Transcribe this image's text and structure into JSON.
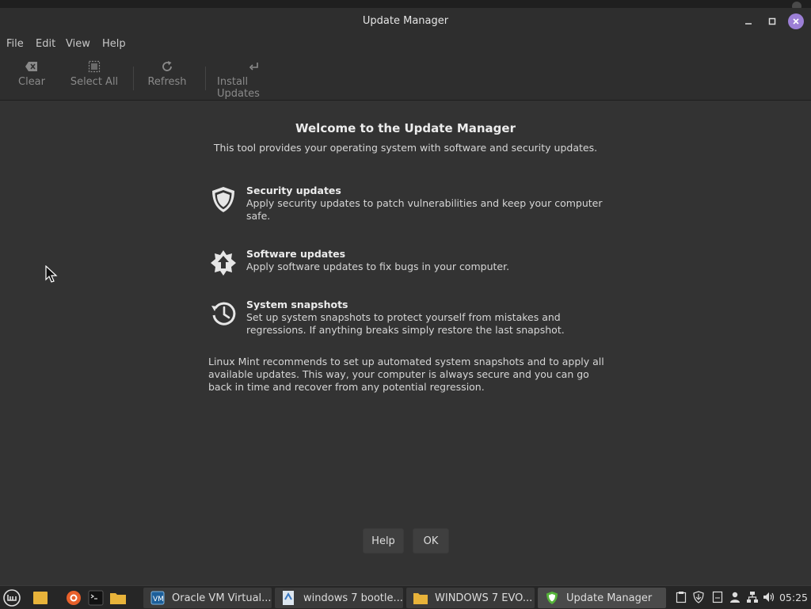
{
  "window": {
    "title": "Update Manager",
    "controls": {
      "minimize": "–",
      "maximize": "□",
      "close": "✕"
    }
  },
  "menubar": [
    "File",
    "Edit",
    "View",
    "Help"
  ],
  "toolbar": {
    "clear": {
      "label": "Clear",
      "icon": "clear-icon"
    },
    "select_all": {
      "label": "Select All",
      "icon": "select-all-icon"
    },
    "refresh": {
      "label": "Refresh",
      "icon": "refresh-icon"
    },
    "install": {
      "label": "Install Updates",
      "icon": "install-icon"
    }
  },
  "welcome": {
    "title": "Welcome to the Update Manager",
    "subtitle": "This tool provides your operating system with software and security updates.",
    "features": [
      {
        "heading": "Security updates",
        "description": "Apply security updates to patch vulnerabilities and keep your computer safe.",
        "icon": "shield-icon"
      },
      {
        "heading": "Software updates",
        "description": "Apply software updates to fix bugs in your computer.",
        "icon": "upgrade-star-icon"
      },
      {
        "heading": "System snapshots",
        "description": "Set up system snapshots to protect yourself from mistakes and regressions. If anything breaks simply restore the last snapshot.",
        "icon": "history-icon"
      }
    ],
    "recommendation": "Linux Mint recommends to set up automated system snapshots and to apply all available updates. This way, your computer is always secure and you can go back in time and recover from any potential regression.",
    "buttons": {
      "help": "Help",
      "ok": "OK"
    }
  },
  "taskbar": {
    "windows": [
      {
        "label": "Oracle VM Virtual...",
        "icon": "virtualbox-icon"
      },
      {
        "label": "windows 7 bootle...",
        "icon": "document-viewer-icon"
      },
      {
        "label": "WINDOWS 7 EVO...",
        "icon": "folder-icon"
      },
      {
        "label": "Update Manager",
        "icon": "shield-icon",
        "active": true
      }
    ],
    "clock": "05:25"
  },
  "colors": {
    "window_bg": "#333333",
    "titlebar_bg": "#2e2e2e",
    "close_button": "#9c7fd6",
    "taskbar_bg": "#262626"
  }
}
